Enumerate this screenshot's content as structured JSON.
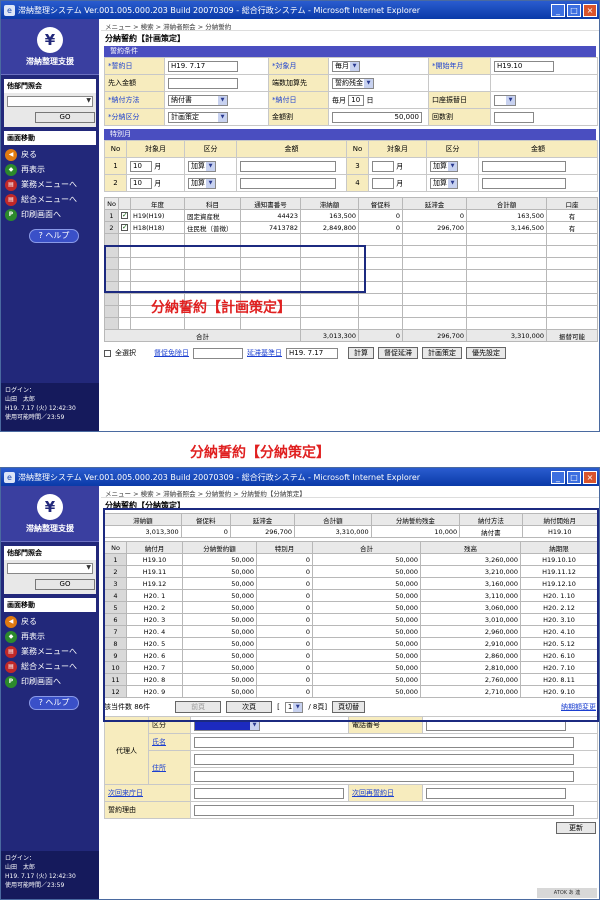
{
  "window": {
    "title": "滞納整理システム Ver.001.005.000.203 Build 20070309 - 総合行政システム - Microsoft Internet Explorer"
  },
  "sidebar": {
    "app_name": "滞納整理支援",
    "logo_glyph": "¥",
    "section_other": "他部門照会",
    "go_label": "GO",
    "section_nav": "画面移動",
    "nav_items": [
      "戻る",
      "再表示",
      "業務メニューへ",
      "総合メニューへ",
      "印刷画面へ"
    ],
    "nav_icons": [
      "back-icon",
      "refresh-icon",
      "menu-icon",
      "menu-icon",
      "print-icon"
    ],
    "help_label": "ヘルプ",
    "login_label": "ログイン：",
    "user_name": "山田　太郎",
    "login_time": "H19. 7.17 (火) 12:42:30",
    "available_time": "使用可能時間／23:59"
  },
  "screen1": {
    "breadcrumb": "メニュー > 検索 > 滞納者照会 > 分納誓約",
    "title": "分納誓約【計画策定】",
    "cond_header": "誓約条件",
    "fields": {
      "pledge_date_label": "誓約日",
      "pledge_date": "H19. 7.17",
      "target_month_label": "対象月",
      "target_month": "毎月",
      "start_ym_label": "開始年月",
      "start_ym": "H19.10",
      "advance_label": "先入金額",
      "advance": "",
      "shortfall_label": "端数加算先",
      "shortfall": "誓約残金",
      "pay_method_label": "納付方法",
      "pay_method": "納付書",
      "pay_day_label": "納付日",
      "pay_day_prefix": "毎月",
      "pay_day": "10",
      "pay_day_suffix": "日",
      "transfer_label": "口座振替日",
      "transfer": "",
      "split_type_label": "分納区分",
      "split_type": "計画策定",
      "split_amt_label": "金額割",
      "split_amt": "50,000",
      "count_label": "回数割",
      "count": ""
    },
    "special_header": "特別月",
    "special_cols": [
      "No",
      "対象月",
      "区分",
      "金額",
      "No",
      "対象月",
      "区分",
      "金額"
    ],
    "special_rows": [
      {
        "no": "1",
        "month": "10",
        "unit": "月",
        "kind": "加算",
        "amount": "",
        "no2": "3",
        "month2": "",
        "unit2": "月",
        "kind2": "加算",
        "amount2": ""
      },
      {
        "no": "2",
        "month": "10",
        "unit": "月",
        "kind": "加算",
        "amount": "",
        "no2": "4",
        "month2": "",
        "unit2": "月",
        "kind2": "加算",
        "amount2": ""
      }
    ],
    "tax_cols": [
      "No",
      "年度",
      "科目",
      "通知書番号",
      "滞納額",
      "督促料",
      "延滞金",
      "合計額",
      "口座"
    ],
    "tax_rows": [
      {
        "no": "1",
        "year": "H19(H19)",
        "subject": "固定資産税",
        "notice": "44423",
        "due": "163,500",
        "fee": "0",
        "late": "0",
        "total": "163,500",
        "acct": "有"
      },
      {
        "no": "2",
        "year": "H18(H18)",
        "subject": "住民税（普徴）",
        "notice": "7413782",
        "due": "2,849,800",
        "fee": "0",
        "late": "296,700",
        "total": "3,146,500",
        "acct": "有"
      }
    ],
    "totals_label": "合計",
    "totals": {
      "due": "3,013,300",
      "fee": "0",
      "late": "296,700",
      "total": "3,310,000",
      "acct": "振替可能"
    },
    "select_all": "全選択",
    "exempt_label": "督促免除日",
    "extend_label": "延滞基準日",
    "extend_value": "H19. 7.17",
    "buttons": [
      "計算",
      "督促延滞",
      "計画策定",
      "優先設定"
    ]
  },
  "caption1": "分納誓約【計画策定】",
  "caption2": "分納誓約【分納策定】",
  "screen2": {
    "breadcrumb": "メニュー > 検索 > 滞納者照会 > 分納誓約 > 分納誓約【分納策定】",
    "title": "分納誓約【分納策定】",
    "summary_cols": [
      "滞納額",
      "督促料",
      "延滞金",
      "合計額",
      "分納誓約残金",
      "納付方法",
      "納付開始月"
    ],
    "summary_vals": [
      "3,013,300",
      "0",
      "296,700",
      "3,310,000",
      "10,000",
      "納付書",
      "H19.10"
    ],
    "plan_cols": [
      "No",
      "納付月",
      "分納誓約額",
      "特別月",
      "合計",
      "残高",
      "納期限"
    ],
    "plan_rows": [
      [
        "1",
        "H19.10",
        "50,000",
        "0",
        "50,000",
        "3,260,000",
        "H19.10.10"
      ],
      [
        "2",
        "H19.11",
        "50,000",
        "0",
        "50,000",
        "3,210,000",
        "H19.11.12"
      ],
      [
        "3",
        "H19.12",
        "50,000",
        "0",
        "50,000",
        "3,160,000",
        "H19.12.10"
      ],
      [
        "4",
        "H20. 1",
        "50,000",
        "0",
        "50,000",
        "3,110,000",
        "H20. 1.10"
      ],
      [
        "5",
        "H20. 2",
        "50,000",
        "0",
        "50,000",
        "3,060,000",
        "H20. 2.12"
      ],
      [
        "6",
        "H20. 3",
        "50,000",
        "0",
        "50,000",
        "3,010,000",
        "H20. 3.10"
      ],
      [
        "7",
        "H20. 4",
        "50,000",
        "0",
        "50,000",
        "2,960,000",
        "H20. 4.10"
      ],
      [
        "8",
        "H20. 5",
        "50,000",
        "0",
        "50,000",
        "2,910,000",
        "H20. 5.12"
      ],
      [
        "9",
        "H20. 6",
        "50,000",
        "0",
        "50,000",
        "2,860,000",
        "H20. 6.10"
      ],
      [
        "10",
        "H20. 7",
        "50,000",
        "0",
        "50,000",
        "2,810,000",
        "H20. 7.10"
      ],
      [
        "11",
        "H20. 8",
        "50,000",
        "0",
        "50,000",
        "2,760,000",
        "H20. 8.11"
      ],
      [
        "12",
        "H20. 9",
        "50,000",
        "0",
        "50,000",
        "2,710,000",
        "H20. 9.10"
      ]
    ],
    "count_label": "該当件数 86件",
    "prev_label": "前頁",
    "next_label": "次頁",
    "page_open": "[",
    "page_value": "1",
    "page_total": "/ 8頁]",
    "page_switch": "頁切替",
    "amount_change": "納期額変更",
    "agent_label": "代理人",
    "kubun_label": "区分",
    "phone_label": "電話番号",
    "name_label": "氏名",
    "address_label": "住所",
    "next_visit_label": "次回来庁日",
    "next_pledge_label": "次回再誓約日",
    "reason_label": "誓約理由",
    "update_label": "更新",
    "status_text": "ATOK あ 連"
  }
}
